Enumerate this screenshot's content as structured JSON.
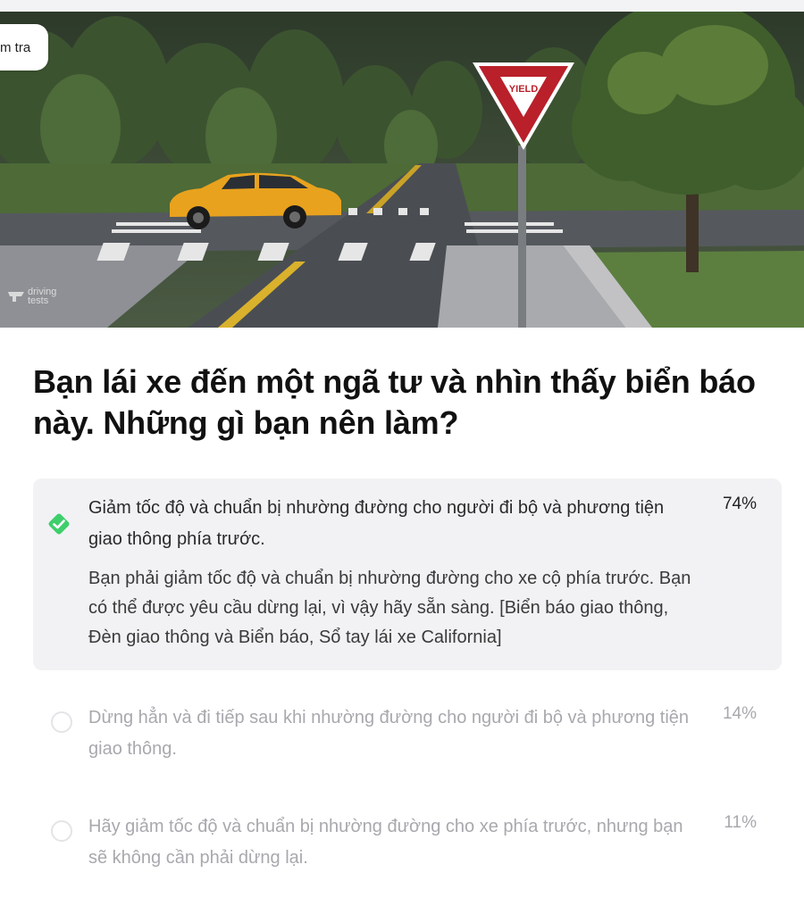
{
  "badge": {
    "label": "m tra"
  },
  "scene": {
    "sign_text": "YIELD",
    "watermark_line1": "driving",
    "watermark_line2": "tests"
  },
  "question": {
    "text": "Bạn lái xe đến một ngã tư và nhìn thấy biển báo này. Những gì bạn nên làm?"
  },
  "answers": [
    {
      "text": "Giảm tốc độ và chuẩn bị nhường đường cho người đi bộ và phương tiện giao thông phía trước.",
      "percent": "74%",
      "state": "correct",
      "explanation": "Bạn phải giảm tốc độ và chuẩn bị nhường đường cho xe cộ phía trước. Bạn có thể được yêu cầu dừng lại, vì vậy hãy sẵn sàng. [Biển báo giao thông, Đèn giao thông và Biển báo, Sổ tay lái xe California]"
    },
    {
      "text": "Dừng hẳn và đi tiếp sau khi nhường đường cho người đi bộ và phương tiện giao thông.",
      "percent": "14%",
      "state": "unselected"
    },
    {
      "text": "Hãy giảm tốc độ và chuẩn bị nhường đường cho xe phía trước, nhưng bạn sẽ không cần phải dừng lại.",
      "percent": "11%",
      "state": "unselected"
    }
  ],
  "colors": {
    "check_green": "#3ecf6b",
    "correct_bg": "#f2f2f5",
    "muted_text": "#a8a8ae"
  },
  "icons": {
    "correct": "check-diamond-icon",
    "unselected": "radio-circle-icon"
  }
}
